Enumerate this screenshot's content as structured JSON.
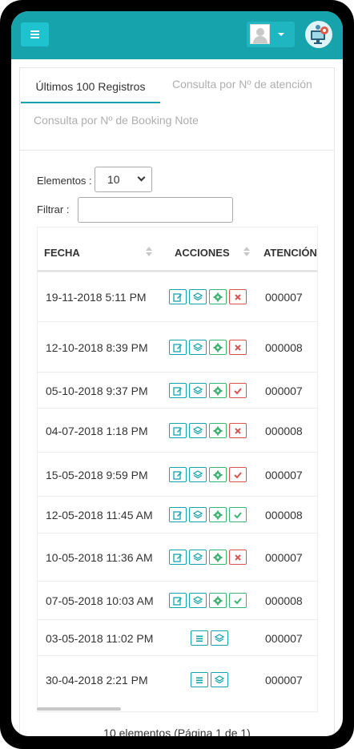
{
  "header": {
    "menu_icon": "hamburger-icon",
    "user_icon": "user-avatar-icon",
    "config_icon": "monitor-gear-icon"
  },
  "tabs": [
    {
      "label": "Últimos 100 Registros",
      "active": true
    },
    {
      "label": "Consulta por Nº de atención",
      "active": false
    },
    {
      "label": "Consulta por Nº de Booking Note",
      "active": false
    }
  ],
  "controls": {
    "elements_label": "Elementos :",
    "elements_value": "10",
    "filter_label": "Filtrar :",
    "filter_value": ""
  },
  "table": {
    "columns": [
      "FECHA",
      "ACCIONES",
      "ATENCIÓN"
    ],
    "rows": [
      {
        "date": "19-11-2018 5:11 PM",
        "attention": "000007",
        "actions": [
          "edit",
          "layers",
          "settings",
          "cancel"
        ]
      },
      {
        "date": "12-10-2018 8:39 PM",
        "attention": "000008",
        "actions": [
          "edit",
          "layers",
          "settings",
          "cancel"
        ]
      },
      {
        "date": "05-10-2018 9:37 PM",
        "attention": "000007",
        "actions": [
          "edit",
          "layers",
          "settings",
          "check-red"
        ]
      },
      {
        "date": "04-07-2018 1:18 PM",
        "attention": "000008",
        "actions": [
          "edit",
          "layers",
          "settings",
          "cancel"
        ]
      },
      {
        "date": "15-05-2018 9:59 PM",
        "attention": "000007",
        "actions": [
          "edit",
          "layers",
          "settings",
          "check-red"
        ]
      },
      {
        "date": "12-05-2018 11:45 AM",
        "attention": "000008",
        "actions": [
          "edit",
          "layers",
          "settings",
          "check-green"
        ]
      },
      {
        "date": "10-05-2018 11:36 AM",
        "attention": "000007",
        "actions": [
          "edit",
          "layers",
          "settings",
          "cancel"
        ]
      },
      {
        "date": "07-05-2018 10:03 AM",
        "attention": "000008",
        "actions": [
          "edit",
          "layers",
          "settings",
          "check-green"
        ]
      },
      {
        "date": "03-05-2018 11:02 PM",
        "attention": "000007",
        "actions": [
          "list",
          "layers"
        ]
      },
      {
        "date": "30-04-2018 2:21 PM",
        "attention": "000007",
        "actions": [
          "list",
          "layers"
        ]
      }
    ]
  },
  "footer": {
    "summary": "10 elementos (Página 1 de 1)"
  },
  "colors": {
    "brand": "#16a3ac",
    "success": "#3cb371",
    "danger": "#d9534f"
  }
}
